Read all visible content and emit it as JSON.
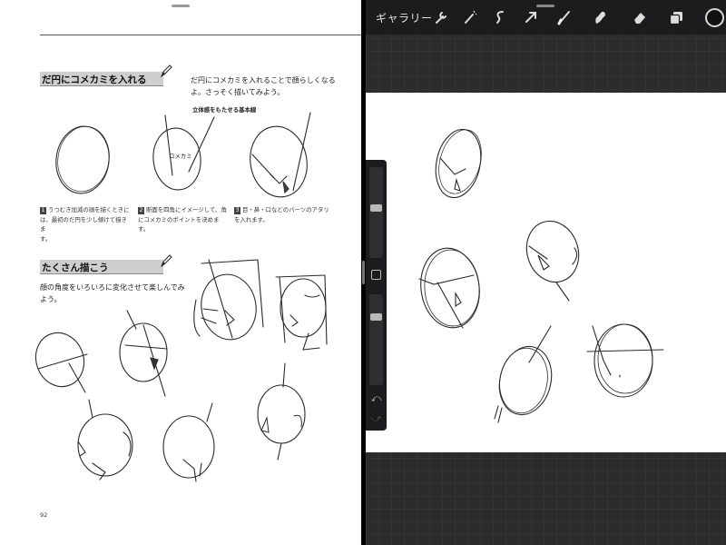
{
  "book": {
    "section1_title": "だ円にコメカミを入れる",
    "section1_intro_line1": "だ円にコメカミを入れることで顔らしくなる",
    "section1_intro_line2": "よ。さっそく描いてみよう。",
    "annotation_basis": "立体感をもたせる基本線",
    "annotation_komekami": "コメカミ",
    "steps": [
      {
        "num": "1",
        "line1": "うつむき加減の顔を描くときに",
        "line2": "は、最初のだ円を少し傾けて描きま",
        "line3": "す。"
      },
      {
        "num": "2",
        "line1": "断面を四角にイメージして、角",
        "line2": "にコメカミのポイントを決めます。",
        "line3": ""
      },
      {
        "num": "3",
        "line1": "目・鼻・口などのパーツのアタリ",
        "line2": "を入れます。",
        "line3": ""
      }
    ],
    "section2_title": "たくさん描こう",
    "section2_intro_line1": "顔の角度をいろいろに変化させて楽しんでみ",
    "section2_intro_line2": "よう。",
    "page_number": "92"
  },
  "app": {
    "gallery_label": "ギャラリー",
    "toolbar_icons": [
      "wrench-icon",
      "magic-wand-icon",
      "selection-icon",
      "transform-arrow-icon",
      "brush-icon",
      "smudge-icon",
      "eraser-icon",
      "layers-icon"
    ],
    "current_color": "#111111",
    "undo_glyph": "⤺",
    "redo_glyph": "⤻"
  }
}
